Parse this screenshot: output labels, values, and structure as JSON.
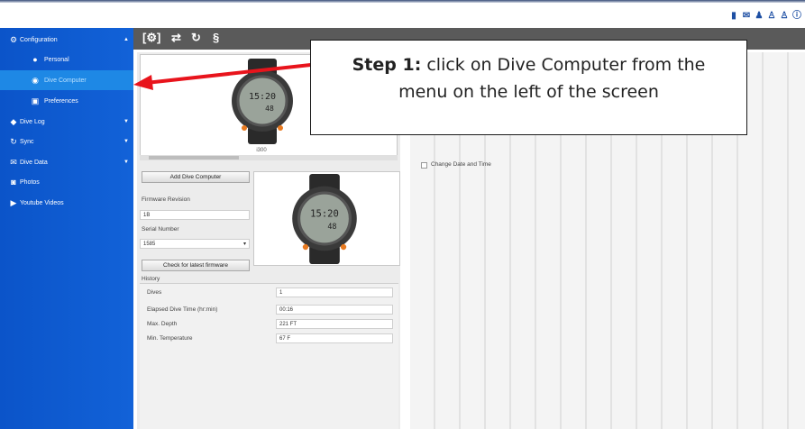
{
  "top_icons": [
    "book-icon",
    "envelope-icon",
    "people-icon",
    "person-download-icon",
    "person-upload-icon",
    "info-icon"
  ],
  "sidebar": {
    "items": [
      {
        "label": "Configuration",
        "icon": "gears-icon",
        "arrow": "▲"
      },
      {
        "label": "Personal",
        "icon": "person-icon"
      },
      {
        "label": "Dive Computer",
        "icon": "dive-computer-icon"
      },
      {
        "label": "Preferences",
        "icon": "preferences-icon"
      },
      {
        "label": "Dive Log",
        "icon": "dive-log-icon",
        "arrow": "▼"
      },
      {
        "label": "Sync",
        "icon": "sync-icon",
        "arrow": "▼"
      },
      {
        "label": "Dive Data",
        "icon": "dive-data-icon",
        "arrow": "▼"
      },
      {
        "label": "Photos",
        "icon": "camera-icon"
      },
      {
        "label": "Youtube Videos",
        "icon": "video-icon"
      }
    ]
  },
  "toolbar": {
    "icons": [
      "settings-icon",
      "sync-arrows-icon",
      "refresh-icon",
      "sliders-icon"
    ]
  },
  "computer": {
    "model": "i300",
    "add_button": "Add Dive Computer",
    "firmware_label": "Firmware Revision",
    "firmware_value": "1B",
    "serial_label": "Serial Number",
    "serial_value": "1585",
    "check_button": "Check for latest firmware"
  },
  "history": {
    "title": "History",
    "rows": [
      {
        "label": "Dives",
        "value": "1"
      },
      {
        "label": "Elapsed Dive Time (hr:min)",
        "value": "00:16"
      },
      {
        "label": "Max. Depth",
        "value": "221 FT"
      },
      {
        "label": "Min. Temperature",
        "value": "67 F"
      }
    ]
  },
  "settings": {
    "change_date_time": "Change Date and Time"
  },
  "callout": {
    "step": "Step 1:",
    "line1": "click on Dive Computer from the",
    "line2": "menu on the left of the screen"
  },
  "colors": {
    "sidebar": "#0b54c9",
    "active_item": "#1e88e5",
    "arrow": "#e8141c"
  }
}
